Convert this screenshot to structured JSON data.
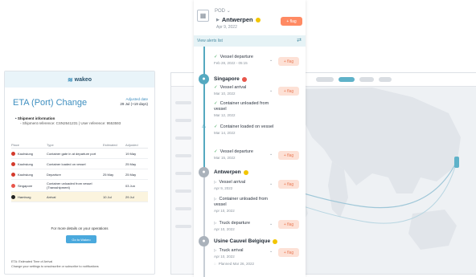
{
  "colors": {
    "accent": "#3f8fc0",
    "teal": "#55a9c0",
    "flag_button": "#ff8a63",
    "highlight_row": "#fbf4de"
  },
  "email": {
    "brand": "wakeo",
    "title": "ETA (Port) Change",
    "adjusted_label": "Adjusted date",
    "adjusted_value": "29 Jul (+19 days)",
    "shipment_info_title": "Shipment information",
    "shipment_reference_line": "Shipment reference: CSN2641231 | User reference: 9553593",
    "columns": [
      "Place",
      "Type",
      "Estimated",
      "Adjusted"
    ],
    "rows": [
      {
        "place": "Kaohsiung",
        "type": "Container gate in at departure port",
        "estimated": "",
        "adjusted": "19 May",
        "flag": "#d33a2c",
        "highlight": false
      },
      {
        "place": "Kaohsiung",
        "type": "Container loaded on vessel",
        "estimated": "",
        "adjusted": "25 May",
        "flag": "#d33a2c",
        "highlight": false
      },
      {
        "place": "Kaohsiung",
        "type": "Departure",
        "estimated": "25 May",
        "adjusted": "25 May",
        "flag": "#d33a2c",
        "highlight": false
      },
      {
        "place": "Singapore",
        "type": "Container unloaded from vessel (Transshipment)",
        "estimated": "",
        "adjusted": "03 Jun",
        "flag": "#e8554a",
        "highlight": false
      },
      {
        "place": "Hamburg",
        "type": "Arrival",
        "estimated": "10 Jul",
        "adjusted": "29 Jul",
        "flag": "#222222",
        "highlight": true
      }
    ],
    "details_text": "For more details on your operations",
    "goto_button": "Go to Wakeo",
    "legal_line1": "ETA: Estimated Time of Arrival",
    "legal_line2": "Change your settings to unsubscribe or subscribe to notifications"
  },
  "timeline": {
    "pod_label": "POD",
    "pod_city": "Antwerpen",
    "pod_date": "Apr 9, 2022",
    "pod_button": "+ flag",
    "view_alerts": "View alerts list",
    "items": [
      {
        "text": "Vessel departure",
        "date": "Feb 28, 2022 - 05:15",
        "state": "done",
        "button": "+ flag"
      },
      {
        "text": "Vessel arrival",
        "date": "Mar 10, 2022",
        "state": "done",
        "button": "+ flag"
      },
      {
        "text": "Container unloaded from vessel",
        "date": "Mar 12, 2022",
        "state": "done",
        "button": ""
      },
      {
        "text": "Container loaded on vessel",
        "date": "Mar 14, 2022",
        "state": "done",
        "button": ""
      },
      {
        "text": "Vessel departure",
        "date": "Mar 15, 2022",
        "state": "done",
        "button": "+ flag"
      },
      {
        "text": "Vessel arrival",
        "date": "Apr 9, 2022",
        "state": "pending",
        "button": "+ flag"
      },
      {
        "text": "Container unloaded from vessel",
        "date": "Apr 10, 2022",
        "state": "pending",
        "button": ""
      },
      {
        "text": "Truck departure",
        "date": "Apr 10, 2022",
        "state": "pending",
        "button": "+ flag"
      },
      {
        "text": "Truck arrival",
        "date": "Apr 10, 2022",
        "state": "pending",
        "button": "+ flag"
      }
    ],
    "stops": [
      {
        "city": "Singapore",
        "flag": "#e8554a"
      },
      {
        "city": "Antwerpen",
        "flag": "#f2c500"
      },
      {
        "city": "Usine Cauvel Belgique",
        "flag": "#f2c500"
      }
    ],
    "planned_text": "Planned Mar 26, 2022"
  }
}
